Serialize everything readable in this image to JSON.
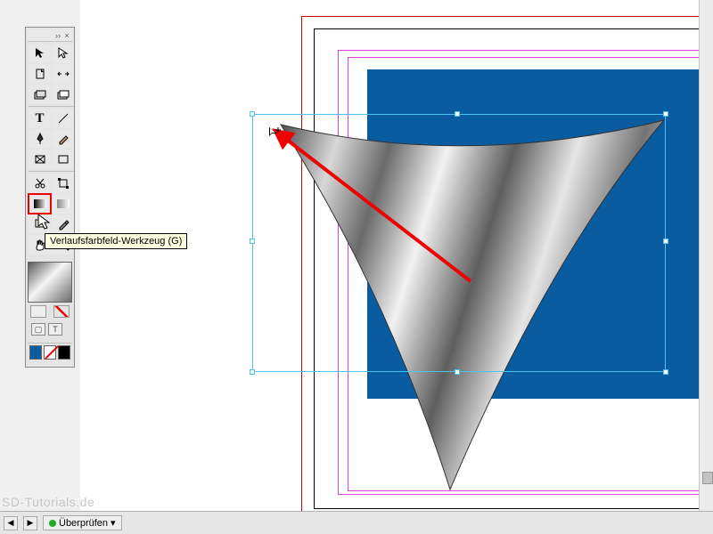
{
  "toolbox": {
    "tools": [
      {
        "name": "selection-tool"
      },
      {
        "name": "direct-selection-tool"
      },
      {
        "name": "page-tool"
      },
      {
        "name": "gap-tool"
      },
      {
        "name": "content-collector-tool"
      },
      {
        "name": "content-placer-tool"
      },
      {
        "name": "type-tool"
      },
      {
        "name": "line-tool"
      },
      {
        "name": "pen-tool"
      },
      {
        "name": "pencil-tool"
      },
      {
        "name": "rectangle-frame-tool"
      },
      {
        "name": "rectangle-tool"
      },
      {
        "name": "scissors-tool"
      },
      {
        "name": "free-transform-tool"
      },
      {
        "name": "gradient-swatch-tool"
      },
      {
        "name": "gradient-feather-tool"
      },
      {
        "name": "note-tool"
      },
      {
        "name": "eyedropper-tool"
      },
      {
        "name": "hand-tool"
      },
      {
        "name": "zoom-tool"
      }
    ],
    "tooltip": "Verlaufsfarbfeld-Werkzeug (G)",
    "highlighted_tool": "gradient-swatch-tool"
  },
  "statusbar": {
    "preflight_label": "Überprüfen"
  },
  "watermark": "SD-Tutorials.de",
  "colors": {
    "blue_rect": "#0a5ca0",
    "selection": "#4fc2f0",
    "guide_red": "#d40000",
    "guide_magenta": "#e040e0",
    "annotation_red": "#f00000"
  },
  "selection": {
    "bounds": "handles on curved triangular gradient shape"
  }
}
